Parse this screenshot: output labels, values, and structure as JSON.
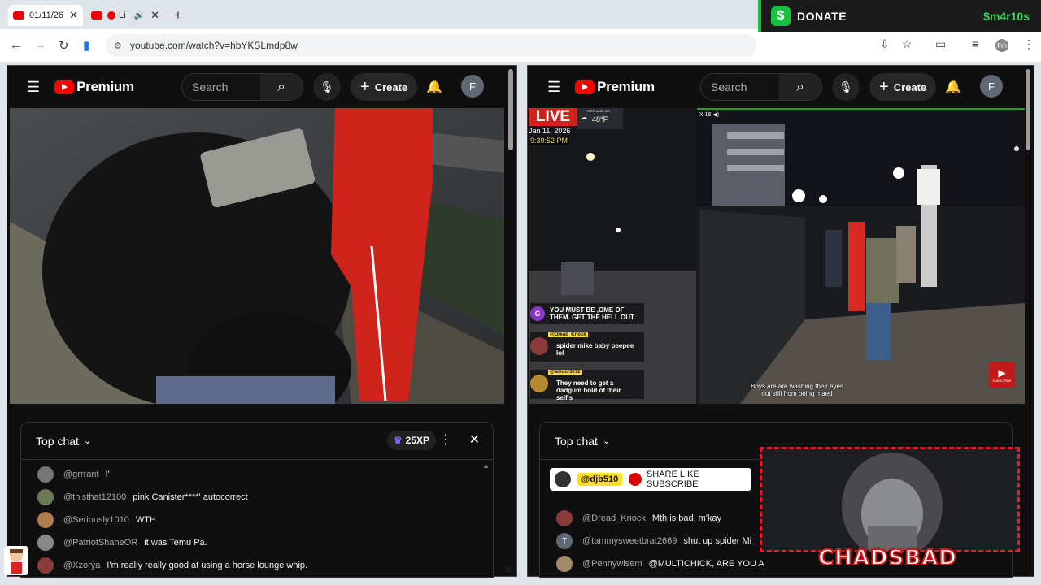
{
  "browser": {
    "tabs": [
      {
        "title": "01/11/26",
        "close": "✕"
      },
      {
        "title": "Li",
        "close": "✕"
      }
    ],
    "new_tab": "+",
    "url": "youtube.com/watch?v=hbYKSLmdp8w"
  },
  "donate_banner": {
    "label": "DONATE",
    "handle": "$m4r10s",
    "accent": "#18c040"
  },
  "left_window": {
    "logo_text": "Premium",
    "search_placeholder": "Search",
    "create_label": "Create",
    "avatar_letter": "F",
    "chat": {
      "header": "Top chat",
      "xp_badge": "25XP",
      "messages": [
        {
          "author": "@grrrant",
          "text": "I'",
          "color": "#777"
        },
        {
          "author": "@thisthat12100",
          "text": "pink Canister****' autocorrect",
          "color": "#6d7a55"
        },
        {
          "author": "@Seriously1010",
          "text": "WTH",
          "color": "#b07d4e"
        },
        {
          "author": "@PatriotShaneOR",
          "text": "it was Temu Pa.",
          "color": "#888"
        },
        {
          "author": "@Xzorya",
          "text": "I'm really really good at using a horse lounge whip.",
          "color": "#8a3c3c"
        }
      ]
    }
  },
  "right_window": {
    "logo_text": "Premium",
    "search_placeholder": "Search",
    "create_label": "Create",
    "avatar_letter": "F",
    "stream_overlay": {
      "live_label": "LIVE",
      "location": "PORTLAND, OR",
      "temperature": "48°F",
      "date": "Jan 11, 2026",
      "time": "9:39:52 PM",
      "viewer_count": "X 16 ◀)",
      "caption_line1": "Boys are are washing their eyes",
      "caption_line2": "out still from being maed",
      "overlay_chat": [
        {
          "user": "",
          "text": "YOU MUST BE ,OME OF THEM. GET THE HELL OUT"
        },
        {
          "user": "@Dread_Knock",
          "text": "spider mike baby peepee lol"
        },
        {
          "user": "@amoor3072",
          "text": "They need to get a dadgum hold of their self's"
        }
      ],
      "subscribe_label": "SUBSCRIBE"
    },
    "chat": {
      "header": "Top chat",
      "pinned": {
        "user": "@djb510",
        "text": "SHARE LIKE SUBSCRIBE"
      },
      "messages": [
        {
          "author": "@Dread_Knock",
          "text": "Mth is bad, m'kay",
          "color": "#8a3c3c"
        },
        {
          "author": "@tammysweetbrat2669",
          "text": "shut up spider Mi",
          "color": "#5f6873",
          "letter": "T"
        },
        {
          "author": "@Pennywisem",
          "text": "@MULTICHICK, ARE YOU A",
          "color": "#a08b6a"
        }
      ]
    }
  },
  "webcam_overlay": {
    "brand": "CHADSBAD"
  }
}
